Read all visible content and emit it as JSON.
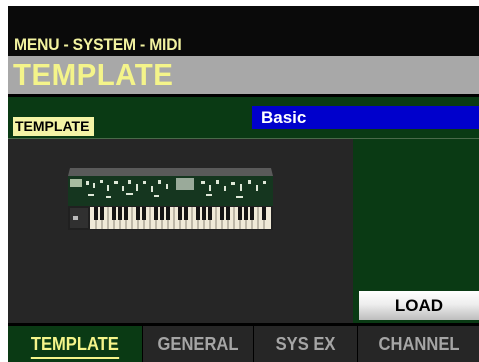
{
  "header": {
    "breadcrumb": "MENU - SYSTEM - MIDI",
    "title": "TEMPLATE"
  },
  "parameter": {
    "label": "TEMPLATE",
    "value": "Basic"
  },
  "load_button": "LOAD",
  "tabs": [
    {
      "label": "TEMPLATE",
      "active": true
    },
    {
      "label": "GENERAL",
      "active": false
    },
    {
      "label": "SYS EX",
      "active": false
    },
    {
      "label": "CHANNEL",
      "active": false
    }
  ],
  "colors": {
    "highlight_text": "#f4f48a",
    "selection_bg": "#0000cc",
    "panel_green": "#0a3a14",
    "header_gray": "#a8a8a8"
  },
  "icons": {
    "organ": "keyboard-instrument-icon"
  }
}
